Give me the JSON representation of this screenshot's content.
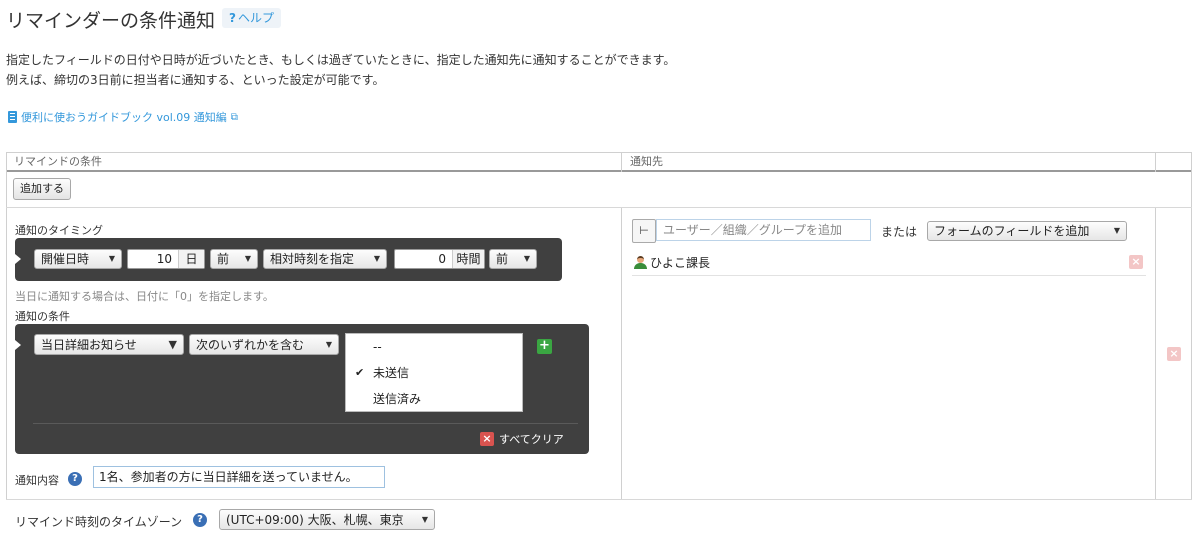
{
  "page": {
    "title": "リマインダーの条件通知",
    "help_icon": "?",
    "help_label": "ヘルプ",
    "description_line1": "指定したフィールドの日付や日時が近づいたとき、もしくは過ぎていたときに、指定した通知先に通知することができます。",
    "description_line2": "例えば、締切の3日前に担当者に通知する、といった設定が可能です。",
    "guide_link": "便利に使おうガイドブック vol.09 通知編",
    "guide_icon": "book-icon",
    "external_icon": "external-link-icon"
  },
  "table": {
    "col_condition": "リマインドの条件",
    "col_recipient": "通知先",
    "add_button": "追加する"
  },
  "timing": {
    "label": "通知のタイミング",
    "field_select": "開催日時",
    "days_value": "10",
    "days_unit": "日",
    "days_direction": "前",
    "time_mode": "相対時刻を指定",
    "hours_value": "0",
    "hours_unit": "時間",
    "hours_direction": "前",
    "hint": "当日に通知する場合は、日付に「0」を指定します。"
  },
  "condition": {
    "label": "通知の条件",
    "field_select": "当日詳細お知らせ",
    "operator_select": "次のいずれかを含む",
    "options": [
      {
        "label": "--",
        "checked": false
      },
      {
        "label": "未送信",
        "checked": true
      },
      {
        "label": "送信済み",
        "checked": false
      }
    ],
    "check_mark": "✔",
    "clear_all": "すべてクリア"
  },
  "content": {
    "label": "通知内容",
    "value": "1名、参加者の方に当日詳細を送っていません。"
  },
  "recipient": {
    "placeholder": "ユーザー／組織／グループを追加",
    "or_text": "または",
    "field_select": "フォームのフィールドを追加",
    "user_name": "ひよこ課長"
  },
  "timezone": {
    "label": "リマインド時刻のタイムゾーン",
    "value": "(UTC+09:00) 大阪、札幌、東京"
  },
  "colors": {
    "accent": "#3498db",
    "dark_panel": "#404040",
    "add_green": "#3aa642",
    "delete_red": "#d9534f"
  }
}
